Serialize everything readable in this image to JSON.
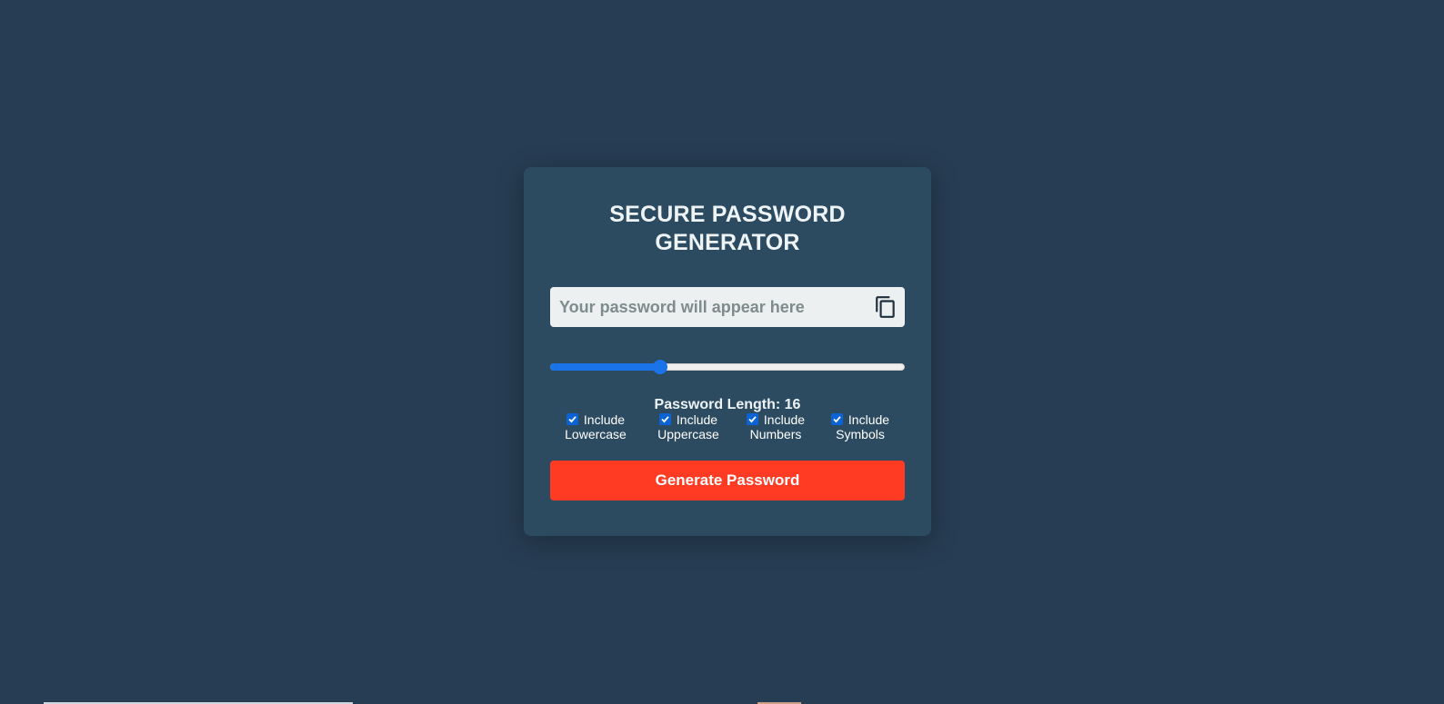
{
  "app": {
    "title": "SECURE PASSWORD GENERATOR"
  },
  "password": {
    "value": "",
    "placeholder": "Your password will appear here",
    "copy_icon": "copy-icon"
  },
  "length": {
    "label": "Password Length: 16",
    "value": 16,
    "slider_fraction": 0.31
  },
  "options": [
    {
      "label_line1": "Include",
      "label_line2": "Lowercase",
      "checked": true
    },
    {
      "label_line1": "Include",
      "label_line2": "Uppercase",
      "checked": true
    },
    {
      "label_line1": "Include",
      "label_line2": "Numbers",
      "checked": true
    },
    {
      "label_line1": "Include",
      "label_line2": "Symbols",
      "checked": true
    }
  ],
  "actions": {
    "generate_label": "Generate Password"
  },
  "colors": {
    "background": "#273d53",
    "card": "#2c4a60",
    "accent": "#1a73e8",
    "button": "#ff3b24"
  }
}
